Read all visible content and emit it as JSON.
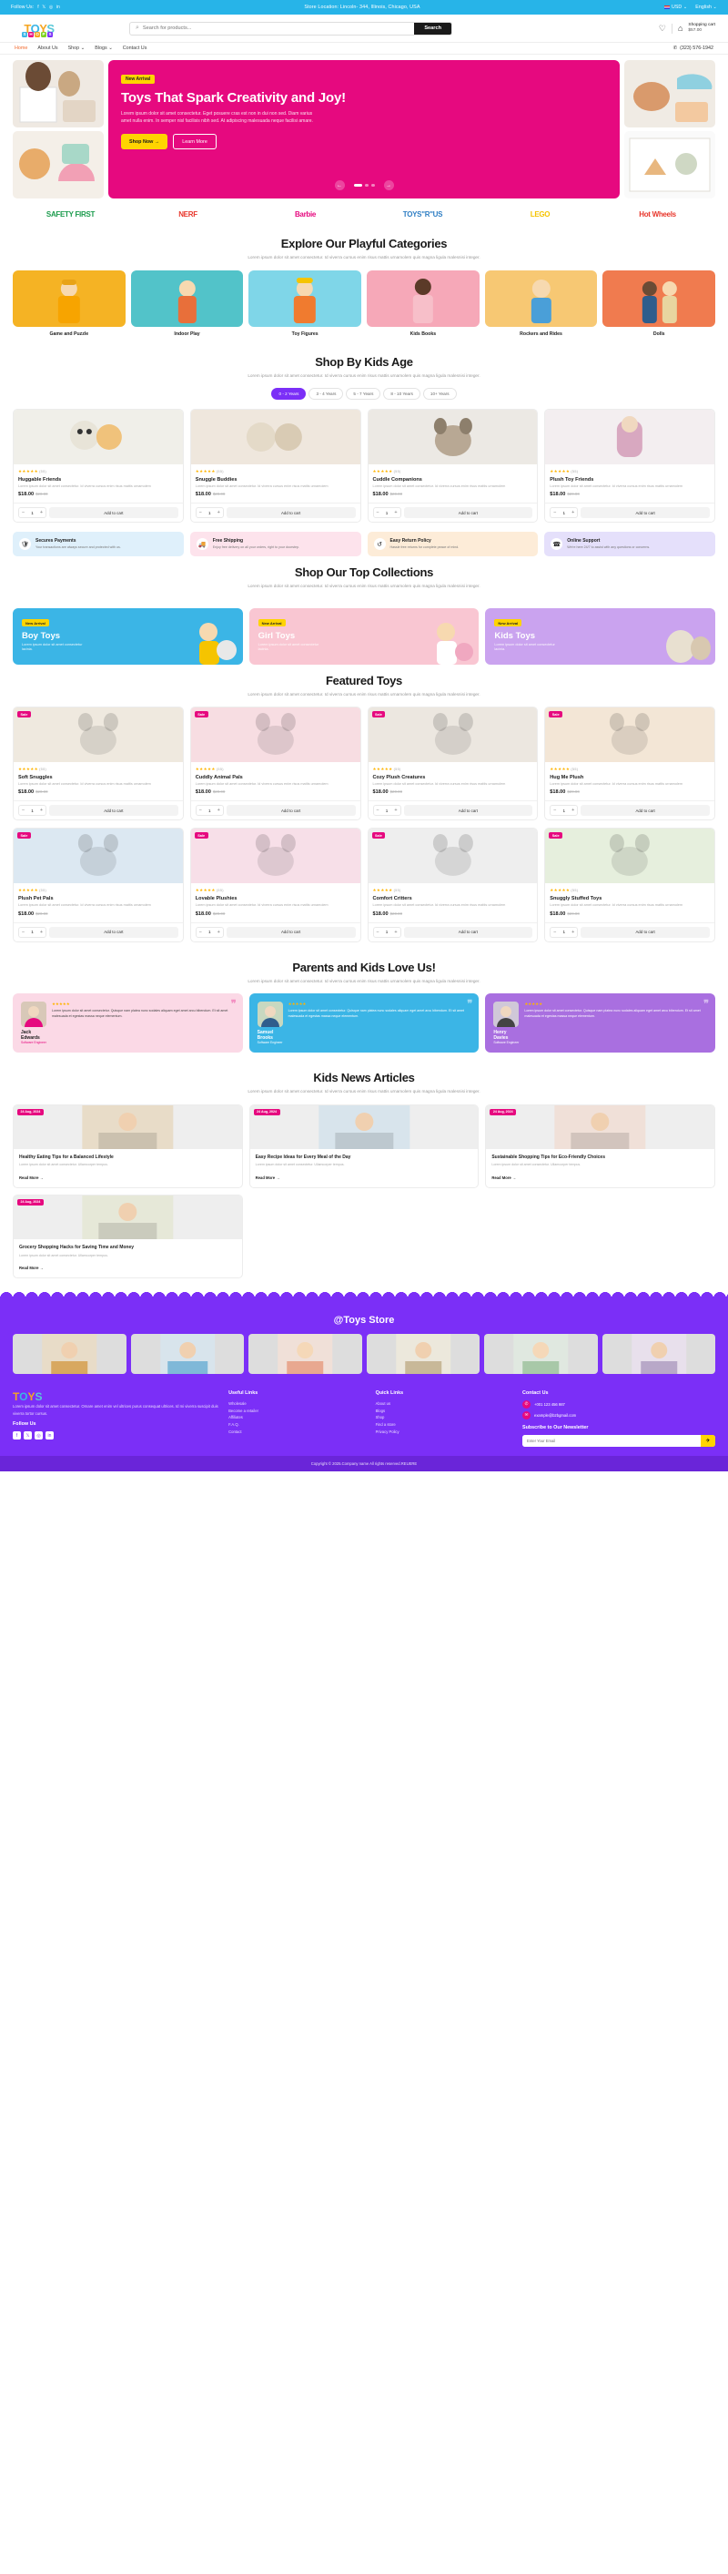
{
  "topbar": {
    "follow_label": "Follow Us:",
    "socials": [
      "facebook-icon",
      "x-icon",
      "instagram-icon",
      "linkedin-icon"
    ],
    "store_location": "Store Location: Lincoln- 344, Illinois, Chicago, USA",
    "currency": "USD",
    "language": "English"
  },
  "header": {
    "logo_main": "TOYS",
    "logo_sub": [
      "S",
      "H",
      "O",
      "P",
      "S"
    ],
    "search_placeholder": "Search for products...",
    "search_button": "Search",
    "cart_label": "Shopping cart",
    "cart_total": "$57.00"
  },
  "nav": {
    "items": [
      {
        "label": "Home",
        "active": true,
        "caret": false
      },
      {
        "label": "About Us",
        "active": false,
        "caret": false
      },
      {
        "label": "Shop",
        "active": false,
        "caret": true
      },
      {
        "label": "Blogs",
        "active": false,
        "caret": true
      },
      {
        "label": "Contact Us",
        "active": false,
        "caret": false
      }
    ],
    "phone": "(323) 576-1942"
  },
  "hero": {
    "badge": "New Arrival",
    "title": "Toys That Spark Creativity and Joy!",
    "desc": "Lorem ipsum dolor sit amet consectetur. Eget posuere cras est non in dui non sed. Diam varius amet nulla enim. In semper nisl facilisis nibh sed. At adipiscing malesuada neque facilisi amare.",
    "btn_primary": "Shop Now",
    "btn_secondary": "Learn More",
    "bg_color": "#e6097f"
  },
  "brands": [
    "SAFETY FIRST",
    "NERF",
    "Barbie",
    "TOYS\"R\"US",
    "LEGO",
    "Hot Wheels"
  ],
  "categories_section": {
    "title": "Explore Our Playful Categories",
    "subtitle": "Lorem ipsum dolor sit amet consectetur. Id viverra cursus enim risus mattis urnamolem quis magna ligula malesnisi integer.",
    "items": [
      {
        "name": "Game and Puzzle",
        "color": "#f5b324"
      },
      {
        "name": "Indoor Play",
        "color": "#52c3c9"
      },
      {
        "name": "Toy Figures",
        "color": "#7fd6e8"
      },
      {
        "name": "Kids Books",
        "color": "#f6a8b8"
      },
      {
        "name": "Rockers and Rides",
        "color": "#f7c873"
      },
      {
        "name": "Dolls",
        "color": "#f07b4f"
      }
    ]
  },
  "age_section": {
    "title": "Shop By Kids Age",
    "subtitle": "Lorem ipsum dolor sit amet consectetur. Id viverra cursus enim risus mattis urnamolem quis magna ligula malesnisi integer.",
    "pills": [
      "0 - 2 Years",
      "3 - 4 Years",
      "5 - 7 Years",
      "8 - 10 Years",
      "10+ Years"
    ],
    "active_pill": 0,
    "products": [
      {
        "name": "Huggable Friends",
        "rating": "★★★★★",
        "reviews": "(55)",
        "desc": "Lorem ipsum dolor sit amet consectetur. Id viverra cursus enim risus mattis urnamolem",
        "price": "$18.00",
        "old_price": "$20.00",
        "qty": "1",
        "add_label": "Add to cart",
        "bg": "#f0efe9"
      },
      {
        "name": "Snuggle Buddies",
        "rating": "★★★★★",
        "reviews": "(55)",
        "desc": "Lorem ipsum dolor sit amet consectetur. Id viverra cursus enim risus mattis urnamolem",
        "price": "$18.00",
        "old_price": "$20.00",
        "qty": "1",
        "add_label": "Add to cart",
        "bg": "#efe7dd"
      },
      {
        "name": "Cuddle Companions",
        "rating": "★★★★★",
        "reviews": "(55)",
        "desc": "Lorem ipsum dolor sit amet consectetur. Id viverra cursus enim risus mattis urnamolem",
        "price": "$18.00",
        "old_price": "$20.00",
        "qty": "1",
        "add_label": "Add to cart",
        "bg": "#ece9e4"
      },
      {
        "name": "Plush Toy Friends",
        "rating": "★★★★★",
        "reviews": "(55)",
        "desc": "Lorem ipsum dolor sit amet consectetur. Id viverra cursus enim risus mattis urnamolem",
        "price": "$18.00",
        "old_price": "$20.00",
        "qty": "1",
        "add_label": "Add to cart",
        "bg": "#f3eef0"
      }
    ]
  },
  "features": [
    {
      "icon": "shield-icon",
      "title": "Secures Payments",
      "desc": "Your transactions are always secure and protected with us.",
      "bg": "#dff0fb"
    },
    {
      "icon": "truck-icon",
      "title": "Free Shipping",
      "desc": "Enjoy free delivery on all your orders, right to your doorstep.",
      "bg": "#fde3ec"
    },
    {
      "icon": "refresh-icon",
      "title": "Easy Return Policy",
      "desc": "Hassle free returns for complete peace of mind.",
      "bg": "#fdecd8"
    },
    {
      "icon": "headset-icon",
      "title": "Online Support",
      "desc": "We're here 24/7 to assist with any questions or concerns.",
      "bg": "#e5e0fb"
    }
  ],
  "collections_section": {
    "title": "Shop Our Top Collections",
    "subtitle": "Lorem ipsum dolor sit amet consectetur. Id viverra cursus enim risus mattis urnamolem quis magna ligula malesnisi integer.",
    "items": [
      {
        "badge": "New Arrival",
        "title": "Boy Toys",
        "desc": "Lorem ipsum dolor sit amet consectetur lacinia.",
        "bg": "#3bb5e6"
      },
      {
        "badge": "New Arrival",
        "title": "Girl Toys",
        "desc": "Lorem ipsum dolor sit amet consectetur lacinia.",
        "bg": "#f9c6d2"
      },
      {
        "badge": "New Arrival",
        "title": "Kids Toys",
        "desc": "Lorem ipsum dolor sit amet consectetur lacinia.",
        "bg": "#caa3ef"
      }
    ]
  },
  "featured_section": {
    "title": "Featured Toys",
    "subtitle": "Lorem ipsum dolor sit amet consectetur. Id viverra cursus enim risus mattis urnamolem quis magna ligula malesnisi integer.",
    "products": [
      {
        "sale": "Sale",
        "name": "Soft Snuggles",
        "rating": "★★★★★",
        "reviews": "(55)",
        "desc": "Lorem ipsum dolor sit amet consectetur. Id viverra cursus enim risus mattis urnamolem",
        "price": "$18.00",
        "old_price": "$20.00",
        "qty": "1",
        "add_label": "Add to cart",
        "bg": "#efe9df"
      },
      {
        "sale": "Sale",
        "name": "Cuddly Animal Pals",
        "rating": "★★★★★",
        "reviews": "(55)",
        "desc": "Lorem ipsum dolor sit amet consectetur. Id viverra cursus enim risus mattis urnamolem",
        "price": "$18.00",
        "old_price": "$20.00",
        "qty": "1",
        "add_label": "Add to cart",
        "bg": "#f7dde2"
      },
      {
        "sale": "Sale",
        "name": "Cozy Plush Creatures",
        "rating": "★★★★★",
        "reviews": "(55)",
        "desc": "Lorem ipsum dolor sit amet consectetur. Id viverra cursus enim risus mattis urnamolem",
        "price": "$18.00",
        "old_price": "$20.00",
        "qty": "1",
        "add_label": "Add to cart",
        "bg": "#ece7e0"
      },
      {
        "sale": "Sale",
        "name": "Hug Me Plush",
        "rating": "★★★★★",
        "reviews": "(55)",
        "desc": "Lorem ipsum dolor sit amet consectetur. Id viverra cursus enim risus mattis urnamolem",
        "price": "$18.00",
        "old_price": "$20.00",
        "qty": "1",
        "add_label": "Add to cart",
        "bg": "#f3e6d6"
      },
      {
        "sale": "Sale",
        "name": "Plush Pet Pals",
        "rating": "★★★★★",
        "reviews": "(55)",
        "desc": "Lorem ipsum dolor sit amet consectetur. Id viverra cursus enim risus mattis urnamolem",
        "price": "$18.00",
        "old_price": "$20.00",
        "qty": "1",
        "add_label": "Add to cart",
        "bg": "#dce8f2"
      },
      {
        "sale": "Sale",
        "name": "Lovable Plushies",
        "rating": "★★★★★",
        "reviews": "(55)",
        "desc": "Lorem ipsum dolor sit amet consectetur. Id viverra cursus enim risus mattis urnamolem",
        "price": "$18.00",
        "old_price": "$20.00",
        "qty": "1",
        "add_label": "Add to cart",
        "bg": "#f7dfe8"
      },
      {
        "sale": "Sale",
        "name": "Comfort Critters",
        "rating": "★★★★★",
        "reviews": "(55)",
        "desc": "Lorem ipsum dolor sit amet consectetur. Id viverra cursus enim risus mattis urnamolem",
        "price": "$18.00",
        "old_price": "$20.00",
        "qty": "1",
        "add_label": "Add to cart",
        "bg": "#eeeeee"
      },
      {
        "sale": "Sale",
        "name": "Snuggly Stuffed Toys",
        "rating": "★★★★★",
        "reviews": "(55)",
        "desc": "Lorem ipsum dolor sit amet consectetur. Id viverra cursus enim risus mattis urnamolem",
        "price": "$18.00",
        "old_price": "$20.00",
        "qty": "1",
        "add_label": "Add to cart",
        "bg": "#e6efdd"
      }
    ]
  },
  "testimonials_section": {
    "title": "Parents and Kids Love Us!",
    "subtitle": "Lorem ipsum dolor sit amet consectetur. Id viverra cursus enim risus mattis urnamolem quis magna ligula malesnisi integer.",
    "items": [
      {
        "name": "Jack Edwards",
        "role": "Software Engineer",
        "stars": "★★★★★",
        "text": "Lorem ipsum dolor sit amet consectetur. Quisque nam platea nunc sodales aliquam eget amet arcu bibendum. Et sit amet malesuada et egestas massa neque elementum.",
        "bg": "#fbd9e6"
      },
      {
        "name": "Samuel Brooks",
        "role": "Software Engineer",
        "stars": "★★★★★",
        "text": "Lorem ipsum dolor sit amet consectetur. Quisque nam platea nunc sodales aliquam eget amet arcu bibendum. Et sit amet malesuada et egestas massa neque elementum.",
        "bg": "#3bb5e6"
      },
      {
        "name": "Henry Davies",
        "role": "Software Engineer",
        "stars": "★★★★★",
        "text": "Lorem ipsum dolor sit amet consectetur. Quisque nam platea nunc sodales aliquam eget amet arcu bibendum. Et sit amet malesuada et egestas massa neque elementum.",
        "bg": "#a96fe0"
      }
    ]
  },
  "news_section": {
    "title": "Kids News Articles",
    "subtitle": "Lorem ipsum dolor sit amet consectetur. Id viverra cursus enim risus mattis urnamolem quis magna ligula malesnisi integer.",
    "items": [
      {
        "date": "24 Aug, 2024",
        "title": "Healthy Eating Tips for a Balanced Lifestyle",
        "desc": "Lorem ipsum dolor sit amet consectetur. Ullamcorper tempus.",
        "link": "Read More"
      },
      {
        "date": "24 Aug, 2024",
        "title": "Easy Recipe Ideas for Every Meal of the Day",
        "desc": "Lorem ipsum dolor sit amet consectetur. Ullamcorper tempus.",
        "link": "Read More"
      },
      {
        "date": "24 Aug, 2024",
        "title": "Sustainable Shopping Tips for Eco-Friendly Choices",
        "desc": "Lorem ipsum dolor sit amet consectetur. Ullamcorper tempus.",
        "link": "Read More"
      },
      {
        "date": "24 Aug, 2024",
        "title": "Grocery Shopping Hacks for Saving Time and Money",
        "desc": "Lorem ipsum dolor sit amet consectetur. Ullamcorper tempus.",
        "link": "Read More"
      }
    ]
  },
  "instagram": {
    "title": "@Toys Store"
  },
  "footer": {
    "logo_main": "TOYS",
    "about": "Lorem ipsum dolor sit amet consectetur. Ornare amet enim vel ultrices purus consequat ultrices. Id mi viverra suscipit duis viverra tortor cursus.",
    "follow_title": "Follow Us",
    "socials": [
      "facebook-icon",
      "x-icon",
      "instagram-icon",
      "linkedin-icon"
    ],
    "useful_title": "Useful Links",
    "useful_links": [
      "Wholesale",
      "Become a retailer",
      "Affiliates",
      "F.A.Q.",
      "Contact"
    ],
    "quick_title": "Quick Links",
    "quick_links": [
      "About us",
      "Blogs",
      "Shop",
      "Find a store",
      "Privacy Policy"
    ],
    "contact_title": "Contact Us",
    "phone": "+001 123 456 987",
    "email": "example@b2bgmail.com",
    "newsletter_title": "Subscribe to Our Newsletter",
    "newsletter_placeholder": "Enter Your Email",
    "copyright": "Copyright © 2025.Company name All rights reserved.REUERE"
  }
}
